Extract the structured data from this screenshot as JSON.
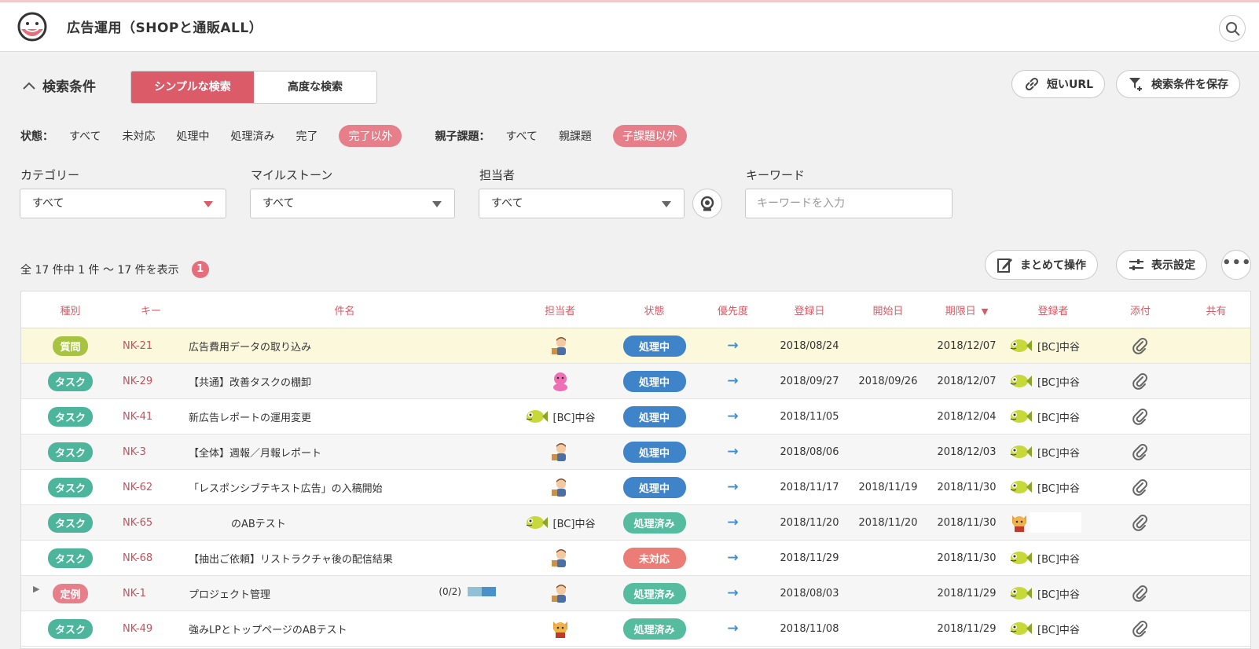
{
  "app": {
    "project_title": "広告運用（SHOPと通販ALL）",
    "search_icon": "search-icon",
    "logo_icon": "smiley-logo-icon"
  },
  "search": {
    "toggle_label": "検索条件",
    "tabs": [
      "シンプルな検索",
      "高度な検索"
    ],
    "active_tab": "シンプルな検索",
    "short_url_label": "短いURL",
    "save_condition_label": "検索条件を保存",
    "status_filter": {
      "label": "状態：",
      "options": [
        "すべて",
        "未対応",
        "処理中",
        "処理済み",
        "完了",
        "完了以外"
      ],
      "selected": "完了以外"
    },
    "parent_filter": {
      "label": "親子課題：",
      "options": [
        "すべて",
        "親課題",
        "子課題以外"
      ],
      "selected": "子課題以外"
    },
    "category": {
      "label": "カテゴリー",
      "value": "すべて"
    },
    "milestone": {
      "label": "マイルストーン",
      "value": "すべて"
    },
    "assignee": {
      "label": "担当者",
      "value": "すべて"
    },
    "keyword": {
      "label": "キーワード",
      "placeholder": "キーワードを入力",
      "value": ""
    }
  },
  "results": {
    "summary": "全 17 件中 1 件 ～ 17 件を表示",
    "badge_count": "1",
    "bulk_action_label": "まとめて操作",
    "display_settings_label": "表示設定",
    "more_label": "•••"
  },
  "colors": {
    "accent": "#dc5b69",
    "type_question": "#a8c341",
    "type_task": "#4cb59b",
    "type_routine": "#e77f8b",
    "status_in_progress": "#3f83c8",
    "status_resolved": "#56bc9f",
    "status_open": "#ec7c76"
  },
  "table": {
    "columns": [
      "種別",
      "キー",
      "件名",
      "担当者",
      "状態",
      "優先度",
      "登録日",
      "開始日",
      "期限日",
      "登録者",
      "添付",
      "共有"
    ],
    "sort_indicator": "▼",
    "rows": [
      {
        "type": "質問",
        "type_color": "#a8c341",
        "key": "NK-21",
        "subject": "広告費用データの取り込み",
        "assignee_icon": "person-avatar-icon",
        "assignee": "",
        "status": "処理中",
        "status_color": "#3f83c8",
        "priority": "→",
        "created": "2018/08/24",
        "start": "",
        "due": "2018/12/07",
        "registrant_icon": "fish-avatar-icon",
        "registrant": "[BC]中谷",
        "attachment": true,
        "highlight": true
      },
      {
        "type": "タスク",
        "type_color": "#4cb59b",
        "key": "NK-29",
        "subject": "【共通】改善タスクの棚卸",
        "assignee_icon": "pink-avatar-icon",
        "assignee": "",
        "status": "処理中",
        "status_color": "#3f83c8",
        "priority": "→",
        "created": "2018/09/27",
        "start": "2018/09/26",
        "due": "2018/12/07",
        "registrant_icon": "fish-avatar-icon",
        "registrant": "[BC]中谷",
        "attachment": true
      },
      {
        "type": "タスク",
        "type_color": "#4cb59b",
        "key": "NK-41",
        "subject": "新広告レポートの運用変更",
        "assignee_icon": "fish-avatar-icon",
        "assignee": "[BC]中谷",
        "status": "処理中",
        "status_color": "#3f83c8",
        "priority": "→",
        "created": "2018/11/05",
        "start": "",
        "due": "2018/12/04",
        "registrant_icon": "fish-avatar-icon",
        "registrant": "[BC]中谷",
        "attachment": true
      },
      {
        "type": "タスク",
        "type_color": "#4cb59b",
        "key": "NK-3",
        "subject": "【全体】週報／月報レポート",
        "assignee_icon": "person-avatar-icon",
        "assignee": "",
        "status": "処理中",
        "status_color": "#3f83c8",
        "priority": "→",
        "created": "2018/08/06",
        "start": "",
        "due": "2018/12/03",
        "registrant_icon": "fish-avatar-icon",
        "registrant": "[BC]中谷",
        "attachment": true
      },
      {
        "type": "タスク",
        "type_color": "#4cb59b",
        "key": "NK-62",
        "subject": "「レスポンシブテキスト広告」の入稿開始",
        "assignee_icon": "person-avatar-icon",
        "assignee": "",
        "status": "処理中",
        "status_color": "#3f83c8",
        "priority": "→",
        "created": "2018/11/17",
        "start": "2018/11/19",
        "due": "2018/11/30",
        "registrant_icon": "fish-avatar-icon",
        "registrant": "[BC]中谷",
        "attachment": true
      },
      {
        "type": "タスク",
        "type_color": "#4cb59b",
        "key": "NK-65",
        "subject": "のABテスト",
        "assignee_icon": "fish-avatar-icon",
        "assignee": "[BC]中谷",
        "status": "処理済み",
        "status_color": "#56bc9f",
        "priority": "→",
        "created": "2018/11/20",
        "start": "2018/11/20",
        "due": "2018/11/30",
        "registrant_icon": "cat-avatar-icon",
        "registrant": "",
        "attachment": true,
        "masked": true
      },
      {
        "type": "タスク",
        "type_color": "#4cb59b",
        "key": "NK-68",
        "subject": "【抽出ご依頼】リストラクチャ後の配信結果",
        "assignee_icon": "person-avatar-icon",
        "assignee": "",
        "status": "未対応",
        "status_color": "#ec7c76",
        "priority": "→",
        "created": "2018/11/29",
        "start": "",
        "due": "2018/11/30",
        "registrant_icon": "fish-avatar-icon",
        "registrant": "[BC]中谷",
        "attachment": false
      },
      {
        "type": "定例",
        "type_color": "#e77f8b",
        "key": "NK-1",
        "subject": "プロジェクト管理",
        "progress": "(0/2)",
        "expandable": true,
        "assignee_icon": "person-avatar-icon",
        "assignee": "",
        "status": "処理済み",
        "status_color": "#56bc9f",
        "priority": "→",
        "created": "2018/08/03",
        "start": "",
        "due": "2018/11/29",
        "registrant_icon": "fish-avatar-icon",
        "registrant": "[BC]中谷",
        "attachment": true
      },
      {
        "type": "タスク",
        "type_color": "#4cb59b",
        "key": "NK-49",
        "subject": "強みLPとトップページのABテスト",
        "assignee_icon": "cat-avatar-icon",
        "assignee": "",
        "status": "処理済み",
        "status_color": "#56bc9f",
        "priority": "→",
        "created": "2018/11/08",
        "start": "",
        "due": "2018/11/29",
        "registrant_icon": "fish-avatar-icon",
        "registrant": "[BC]中谷",
        "attachment": true
      }
    ]
  }
}
